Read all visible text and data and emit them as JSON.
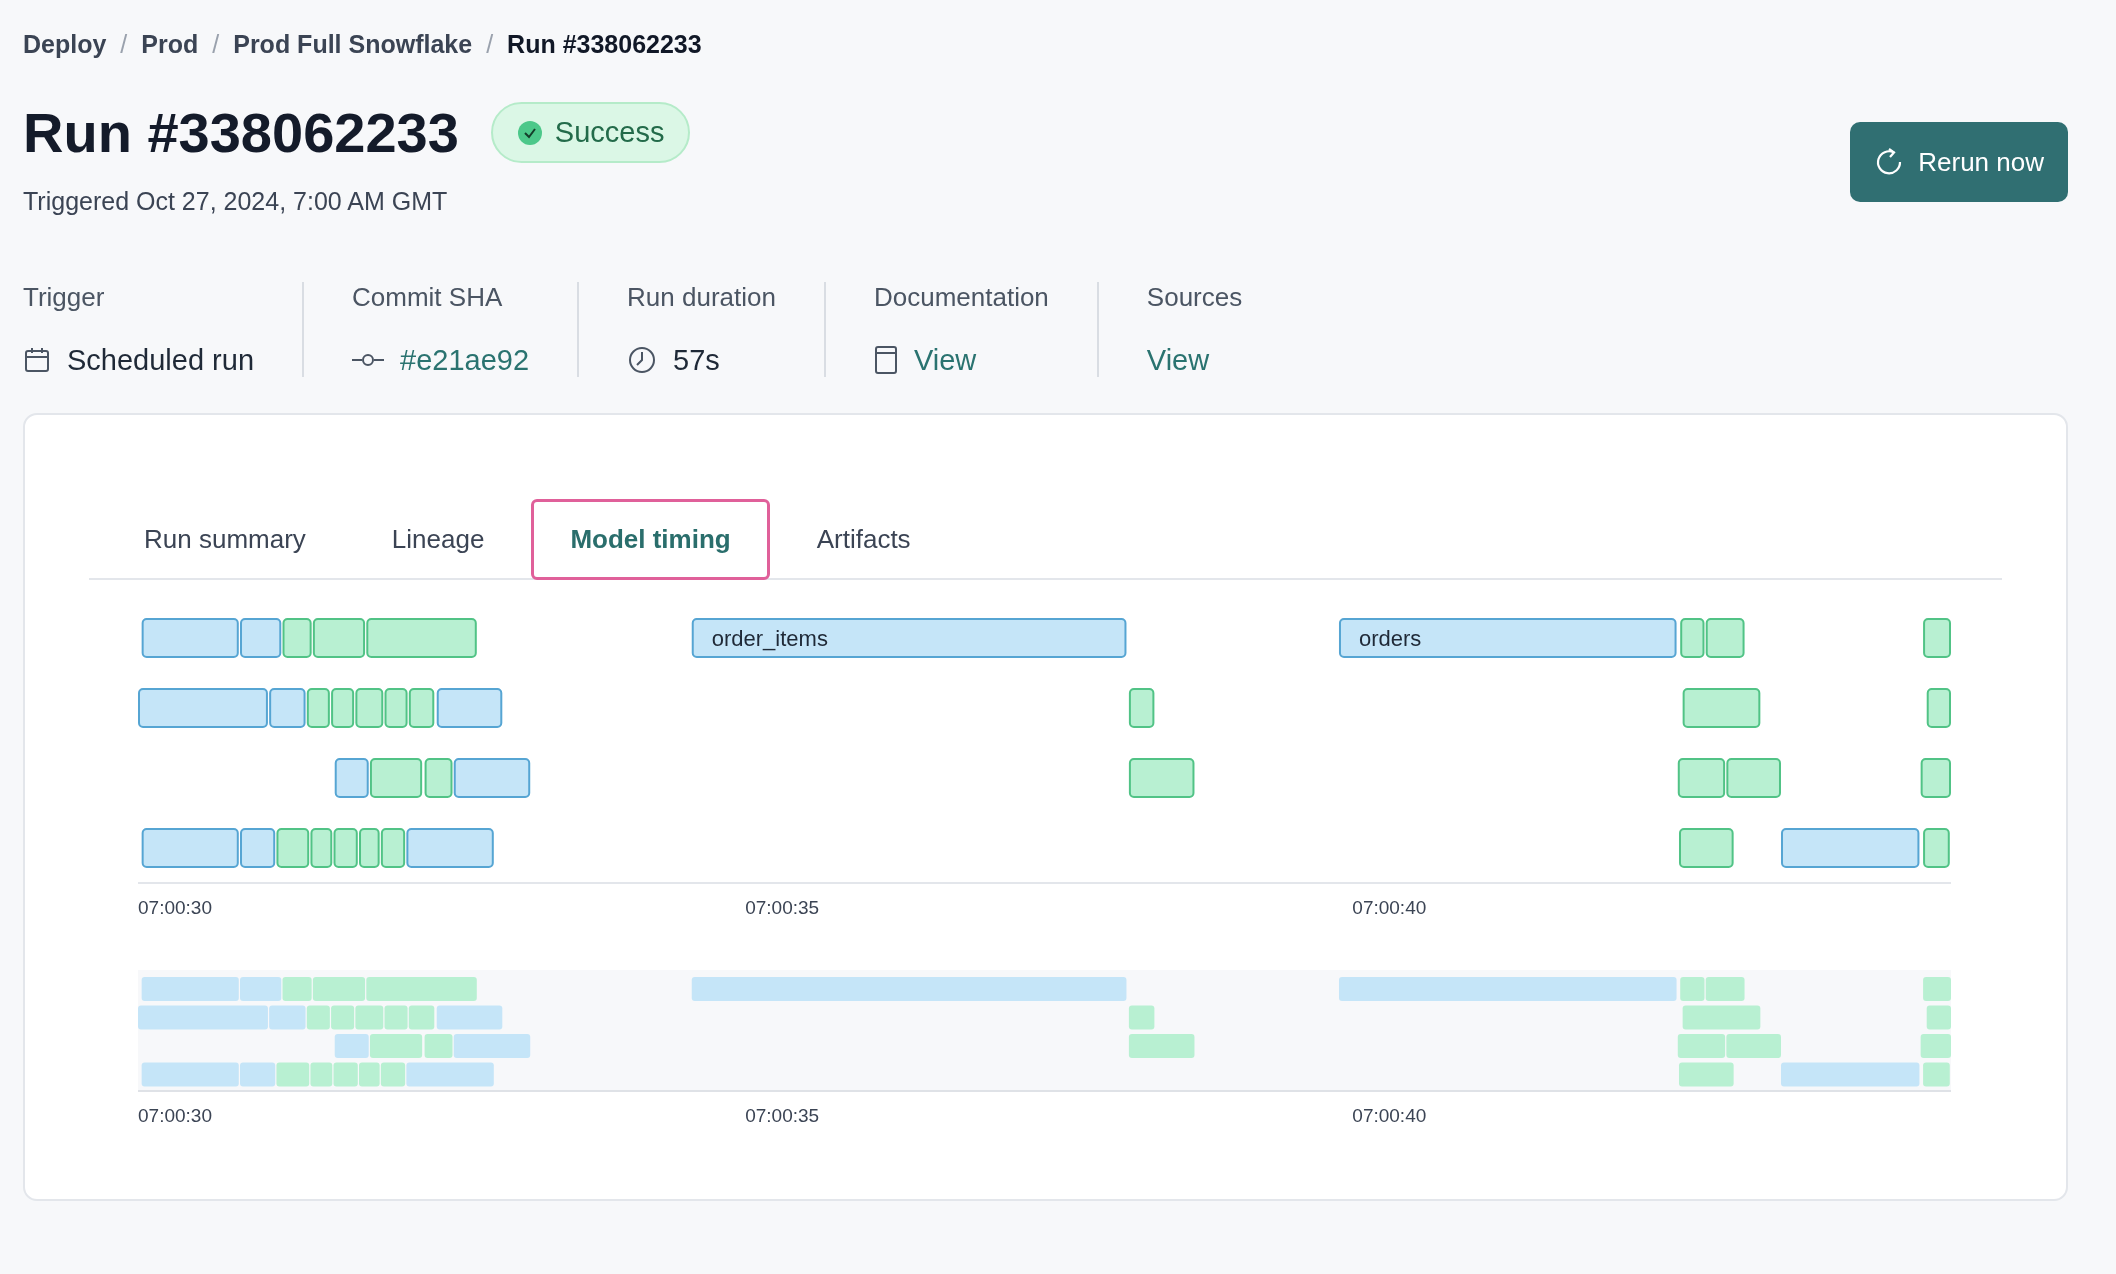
{
  "breadcrumbs": [
    {
      "label": "Deploy",
      "current": false
    },
    {
      "label": "Prod",
      "current": false
    },
    {
      "label": "Prod Full Snowflake",
      "current": false
    },
    {
      "label": "Run #338062233",
      "current": true
    }
  ],
  "breadcrumb_separator": "/",
  "title": "Run #338062233",
  "status_badge": {
    "label": "Success"
  },
  "triggered": "Triggered Oct 27, 2024, 7:00 AM GMT",
  "rerun_button": {
    "label": "Rerun now"
  },
  "meta": [
    {
      "label": "Trigger",
      "value": "Scheduled run",
      "kind": "calendar",
      "link": false
    },
    {
      "label": "Commit SHA",
      "value": "#e21ae92",
      "kind": "commit",
      "link": true
    },
    {
      "label": "Run duration",
      "value": "57s",
      "kind": "clock",
      "link": false
    },
    {
      "label": "Documentation",
      "value": "View",
      "kind": "doc",
      "link": true
    },
    {
      "label": "Sources",
      "value": "View",
      "kind": "none",
      "link": true
    }
  ],
  "tabs": [
    {
      "label": "Run summary",
      "selected": false
    },
    {
      "label": "Lineage",
      "selected": false
    },
    {
      "label": "Model timing",
      "selected": true
    },
    {
      "label": "Artifacts",
      "selected": false
    }
  ],
  "timeline": {
    "lanes": [
      {
        "bars": [
          {
            "color": "#c5e5f8"
          },
          {
            "color": "#c5e5f8"
          },
          {
            "color": "#b8f0d2"
          },
          {
            "color": "#b8f0d2"
          },
          {
            "color": "#b8f0d2"
          },
          {
            "color": "#c5e5f8",
            "label": "order_items"
          },
          {
            "color": "#c5e5f8",
            "label": "orders"
          },
          {
            "color": "#b8f0d2"
          },
          {
            "color": "#b8f0d2"
          },
          {
            "color": "#b8f0d2"
          }
        ]
      },
      {
        "bars": [
          {
            "color": "#c5e5f8"
          },
          {
            "color": "#c5e5f8"
          },
          {
            "color": "#b8f0d2"
          },
          {
            "color": "#b8f0d2"
          },
          {
            "color": "#b8f0d2"
          },
          {
            "color": "#b8f0d2"
          },
          {
            "color": "#b8f0d2"
          },
          {
            "color": "#c5e5f8"
          },
          {
            "color": "#b8f0d2"
          },
          {
            "color": "#b8f0d2"
          },
          {
            "color": "#b8f0d2"
          }
        ]
      },
      {
        "bars": [
          {
            "color": "#c5e5f8"
          },
          {
            "color": "#b8f0d2"
          },
          {
            "color": "#b8f0d2"
          },
          {
            "color": "#c5e5f8"
          },
          {
            "color": "#b8f0d2"
          },
          {
            "color": "#b8f0d2"
          },
          {
            "color": "#b8f0d2"
          },
          {
            "color": "#b8f0d2"
          }
        ]
      },
      {
        "bars": [
          {
            "color": "#c5e5f8"
          },
          {
            "color": "#c5e5f8"
          },
          {
            "color": "#b8f0d2"
          },
          {
            "color": "#b8f0d2"
          },
          {
            "color": "#b8f0d2"
          },
          {
            "color": "#b8f0d2"
          },
          {
            "color": "#b8f0d2"
          },
          {
            "color": "#c5e5f8"
          },
          {
            "color": "#b8f0d2"
          },
          {
            "color": "#c5e5f8"
          },
          {
            "color": "#b8f0d2"
          }
        ]
      }
    ],
    "axis_labels": [
      "07:00:30",
      "07:00:35",
      "07:00:40"
    ]
  },
  "overview": {
    "axis_labels": [
      "07:00:30",
      "07:00:35",
      "07:00:40"
    ]
  }
}
